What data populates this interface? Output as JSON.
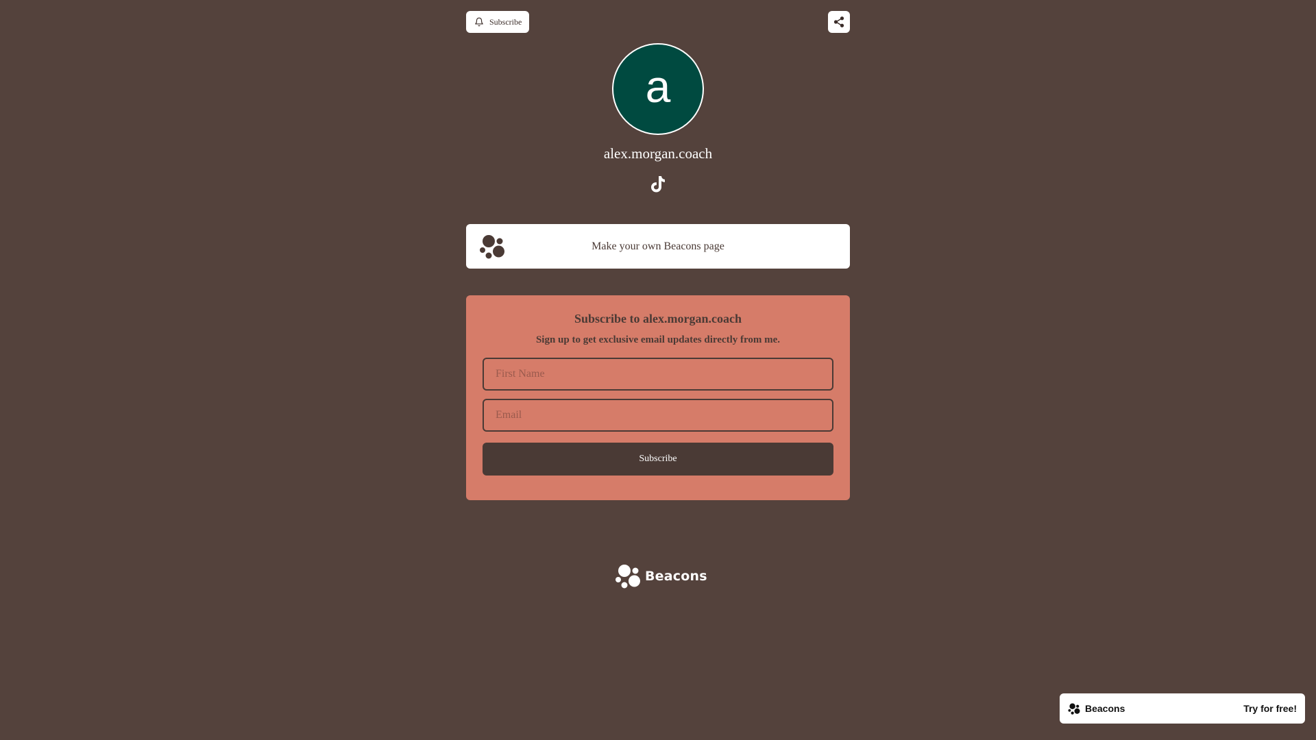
{
  "header": {
    "subscribe_label": "Subscribe",
    "bell_icon": "bell-icon",
    "share_icon": "share-icon"
  },
  "profile": {
    "avatar_letter": "a",
    "avatar_color": "#004a40",
    "username": "alex.morgan.coach",
    "social_icon": "tiktok-icon"
  },
  "link_card": {
    "label": "Make your own Beacons page",
    "icon": "beacons-logo-icon"
  },
  "subscribe_form": {
    "title": "Subscribe to alex.morgan.coach",
    "subtitle": "Sign up to get exclusive email updates directly from me.",
    "first_name_placeholder": "First Name",
    "email_placeholder": "Email",
    "submit_label": "Subscribe",
    "background_color": "#d67c69"
  },
  "footer": {
    "brand": "Beacons"
  },
  "banner": {
    "brand": "Beacons",
    "cta": "Try for free!"
  },
  "colors": {
    "page_background": "#54423c",
    "text_dark": "#4a3a35"
  }
}
